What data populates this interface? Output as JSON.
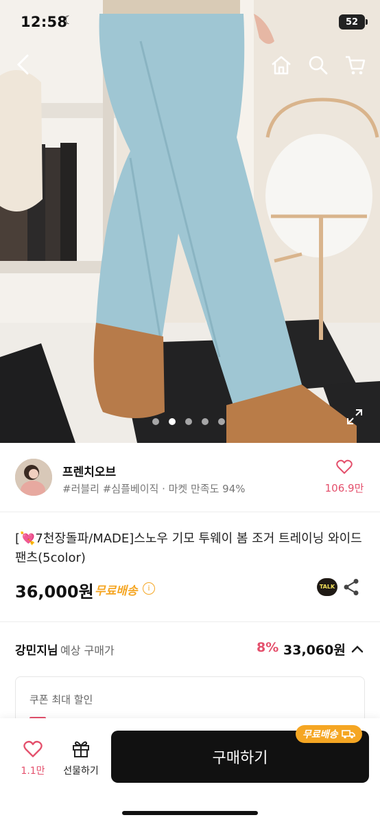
{
  "status": {
    "time": "12:58",
    "battery": "52"
  },
  "hero": {
    "carousel": {
      "count": 5,
      "active_index": 1
    }
  },
  "seller": {
    "name": "프렌치오브",
    "tags": "#러블리 #심플베이직 · 마켓 만족도 94%",
    "likes": "106.9만"
  },
  "product": {
    "title": "[💘7천장돌파/MADE]스노우 기모 투웨이 봄 조거 트레이닝 와이드 팬츠(5color)",
    "price": "36,000원",
    "shipping": "무료배송",
    "talk_label": "TALK"
  },
  "member_price": {
    "name": "강민지님",
    "label": "예상 구매가",
    "discount": "8%",
    "price": "33,060원"
  },
  "coupon": {
    "title": "쿠폰 최대 할인"
  },
  "bottom": {
    "likes": "1.1만",
    "gift_label": "선물하기",
    "buy_label": "구매하기",
    "ship_badge": "무료배송"
  },
  "colors": {
    "accent_pink": "#e4506c",
    "accent_orange": "#f5a623",
    "pants_blue": "#9fc6d3"
  },
  "icons": [
    "back-icon",
    "home-icon",
    "search-icon",
    "cart-icon",
    "expand-icon",
    "heart-icon",
    "info-icon",
    "share-icon",
    "chevron-up-icon",
    "gift-icon",
    "truck-icon"
  ]
}
